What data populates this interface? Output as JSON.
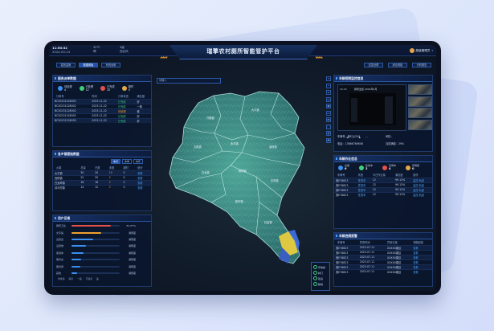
{
  "header": {
    "clock": "11:50:32",
    "date": "2024-05-24",
    "weather_temp": "30℃",
    "weather_desc": "晴",
    "aqi_value": "3级",
    "aqi_label": "西北风",
    "title": "瑞擎农村厕所智能管护平台",
    "user_name": "超级管理员",
    "left_tabs": [
      "智慧监管",
      "数据看板",
      "系统运维"
    ],
    "active_left_tab": 1,
    "right_tabs": [
      "应急处理",
      "综合看板",
      "分析报告"
    ]
  },
  "search": {
    "placeholder": "请输入"
  },
  "map_tools": [
    "+",
    "−",
    "⌂",
    "◎",
    "▦",
    "▭",
    "▤",
    "⬚",
    "▥",
    "⬒"
  ],
  "map_regions": [
    "兴隆镇",
    "大平镇",
    "云集镇",
    "永丰镇",
    "庙坝镇",
    "白龙镇",
    "柳林镇",
    "东风镇",
    "新华镇",
    "红岩镇"
  ],
  "map_legend": [
    {
      "label": "草地类",
      "color": "#3fd07a"
    },
    {
      "label": "林门",
      "color": "#3fd07a"
    },
    {
      "label": "建设",
      "color": "#3fd07a"
    },
    {
      "label": "耕地",
      "color": "#3fd07a"
    }
  ],
  "colors": {
    "accent": "#1f4fa8",
    "link": "#4aa6ff",
    "ok": "#3fd07a",
    "warn": "#f0a030",
    "danger": "#e6524a",
    "water": "#2a5a9a",
    "map_land": "#3e8f86"
  },
  "complaints": {
    "title": "服务派单数据",
    "status": [
      {
        "label": "待处理",
        "value": "4",
        "color": "#3a8ff0"
      },
      {
        "label": "已处理",
        "value": "12",
        "color": "#3fd07a"
      },
      {
        "label": "已完成",
        "value": "32",
        "color": "#e6524a"
      },
      {
        "label": "超时",
        "value": "4",
        "color": "#e6a94a"
      }
    ],
    "columns": [
      "订单号",
      "时间",
      "订单状态",
      "满意度"
    ],
    "rows": [
      [
        "BC20231128002",
        "2023-11-22",
        "已完成",
        "好"
      ],
      [
        "BC20231128002",
        "2023-11-22",
        "已完成",
        "一般"
      ],
      [
        "BC20231128002",
        "2023-11-22",
        "待处理",
        "差"
      ],
      [
        "BC20231128002",
        "2023-11-22",
        "已完成",
        "好"
      ],
      [
        "BC20231128030",
        "2023-11-22",
        "已完成",
        "好"
      ]
    ]
  },
  "towns": {
    "title": "各乡镇报抽数据",
    "tabs": [
      "本月",
      "本季",
      "本年"
    ],
    "active_tab": 0,
    "columns": [
      "乡镇",
      "总量",
      "已报",
      "未报",
      "超时",
      "统计"
    ],
    "rows": [
      [
        "太平镇",
        "30",
        "20",
        "10",
        "0",
        "查看"
      ],
      [
        "西桥镇",
        "22",
        "20",
        "2",
        "0",
        "查看"
      ],
      [
        "白龙岭镇",
        "18",
        "16",
        "2",
        "0",
        "查看"
      ],
      [
        "耳马村镇",
        "14",
        "12",
        "2",
        "0",
        "查看"
      ]
    ]
  },
  "feedback": {
    "title": "用户反馈",
    "items": [
      {
        "label": "厕所卫生",
        "pct": "81.67%",
        "value": 0.8167,
        "color": "#e6524a"
      },
      {
        "label": "文字提",
        "pct": "满意度",
        "value": 0.62,
        "color": "#f0a030"
      },
      {
        "label": "设施运",
        "pct": "满意度",
        "value": 0.45,
        "color": "#3a8ff0"
      },
      {
        "label": "设施维",
        "pct": "满意度",
        "value": 0.3,
        "color": "#3a8ff0"
      },
      {
        "label": "使用体",
        "pct": "满意度",
        "value": 0.25,
        "color": "#3a8ff0"
      },
      {
        "label": "服务态",
        "pct": "满意度",
        "value": 0.2,
        "color": "#3a8ff0"
      },
      {
        "label": "服务质",
        "pct": "满意度",
        "value": 0.18,
        "color": "#3a8ff0"
      },
      {
        "label": "其他",
        "pct": "满意度",
        "value": 0.12,
        "color": "#3a8ff0"
      }
    ],
    "legend": [
      "非常满",
      "满意",
      "一般",
      "不满意",
      "差"
    ]
  },
  "camera": {
    "title": "车辆视频监控信息",
    "feed_title": "厕所监控 2024年4月",
    "feed_time": "00:00",
    "controls": [
      "◀",
      "⏸",
      "▶",
      "⛶"
    ],
    "plate_label": "车牌号：",
    "plate": "冀E11234",
    "driver_label": "司机：",
    "driver": "",
    "phone_label": "电话：",
    "phone": "13866789608",
    "load_label": "当前满载：",
    "load": "29%"
  },
  "vehicles": {
    "title": "车辆作业信息",
    "stats": [
      {
        "label": "总量",
        "value": "6",
        "color": "#3a8ff0"
      },
      {
        "label": "任务中",
        "value": "2",
        "color": "#3fd07a"
      },
      {
        "label": "空闲中",
        "value": "4",
        "color": "#e6524a"
      },
      {
        "label": "待调度",
        "value": "0",
        "color": "#e6a94a"
      }
    ],
    "columns": [
      "车牌号",
      "状态",
      "今日作业量",
      "满意度",
      "操作"
    ],
    "rows": [
      [
        "冀E76823",
        "任务中",
        "12",
        "99.12%",
        "监控 轨迹"
      ],
      [
        "冀E76823",
        "任务中",
        "12",
        "99.12%",
        "监控 轨迹"
      ],
      [
        "冀E76823",
        "任务中",
        "12",
        "99.12%",
        "监控 轨迹"
      ],
      [
        "冀E76823",
        "任务中",
        "12",
        "99.12%",
        "监控 轨迹"
      ]
    ]
  },
  "alarms": {
    "title": "车辆违规报警",
    "columns": [
      "车牌号",
      "异常时间",
      "异常位置",
      "视频回放"
    ],
    "rows": [
      [
        "冀E76823",
        "2023-07-11",
        "XXXXX路边",
        "查看"
      ],
      [
        "冀E76823",
        "2023-07-11",
        "XXXXX路边",
        "查看"
      ],
      [
        "冀E76823",
        "2023-07-11",
        "XXXXX路边",
        "查看"
      ],
      [
        "冀E76823",
        "2023-07-11",
        "XXXXX路边",
        "查看"
      ],
      [
        "冀E76823",
        "2023-07-11",
        "XXXXX路边",
        "查看"
      ],
      [
        "冀E76823",
        "2023-07-11",
        "XXXXX路边",
        "查看"
      ]
    ]
  }
}
